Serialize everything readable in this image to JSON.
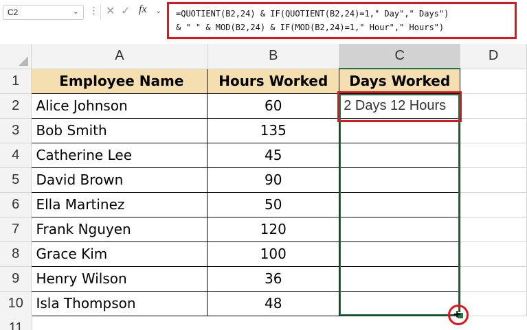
{
  "formula_bar": {
    "name_box": "C2",
    "formula_line1": "=QUOTIENT(B2,24) & IF(QUOTIENT(B2,24)=1,\" Day\",\" Days\")",
    "formula_line2": "& \" \" & MOD(B2,24) & IF(MOD(B2,24)=1,\" Hour\",\" Hours\")",
    "fx_label": "fx"
  },
  "columns": [
    "A",
    "B",
    "C",
    "D"
  ],
  "selected_column": "C",
  "headers": {
    "name": "Employee Name",
    "hours": "Hours Worked",
    "days": "Days Worked"
  },
  "rows": [
    {
      "num": "1"
    },
    {
      "num": "2",
      "name": "Alice Johnson",
      "hours": "60",
      "days": "2 Days 12 Hours"
    },
    {
      "num": "3",
      "name": "Bob Smith",
      "hours": "135",
      "days": ""
    },
    {
      "num": "4",
      "name": "Catherine Lee",
      "hours": "45",
      "days": ""
    },
    {
      "num": "5",
      "name": "David Brown",
      "hours": "90",
      "days": ""
    },
    {
      "num": "6",
      "name": "Ella Martinez",
      "hours": "50",
      "days": ""
    },
    {
      "num": "7",
      "name": "Frank Nguyen",
      "hours": "120",
      "days": ""
    },
    {
      "num": "8",
      "name": "Grace Kim",
      "hours": "100",
      "days": ""
    },
    {
      "num": "9",
      "name": "Henry Wilson",
      "hours": "36",
      "days": ""
    },
    {
      "num": "10",
      "name": "Isla Thompson",
      "hours": "48",
      "days": ""
    }
  ],
  "next_row": "11",
  "colors": {
    "header_fill": "#f5dfb0",
    "selection": "#217346",
    "highlight": "#e0141e"
  }
}
